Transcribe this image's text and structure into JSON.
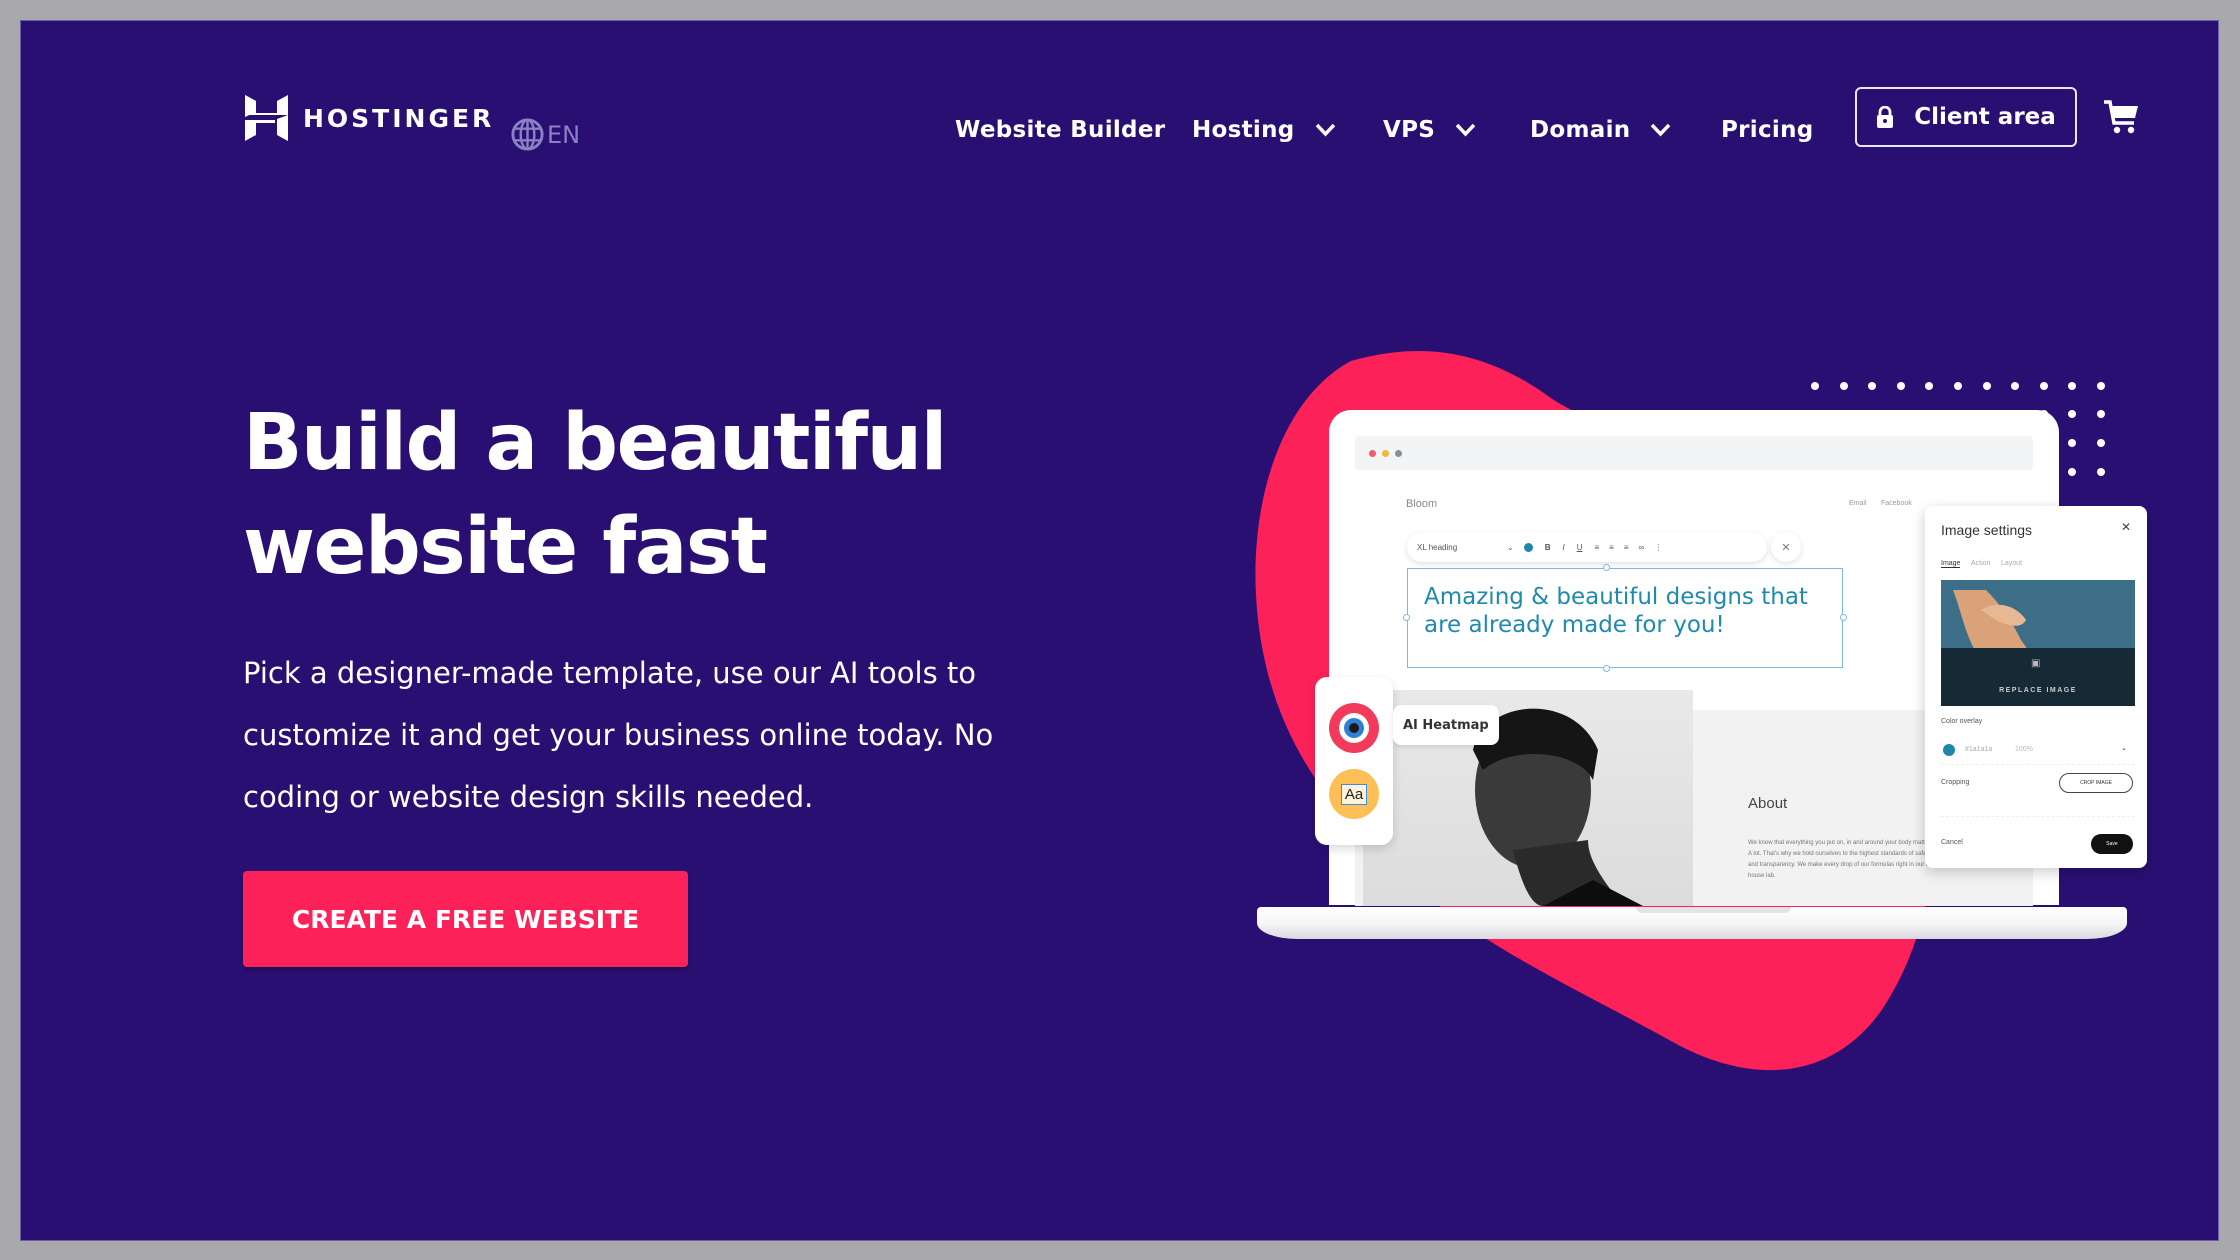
{
  "header": {
    "brand": "HOSTINGER",
    "language": "EN",
    "nav": [
      {
        "label": "Website Builder",
        "has_dropdown": false
      },
      {
        "label": "Hosting",
        "has_dropdown": true
      },
      {
        "label": "VPS",
        "has_dropdown": true
      },
      {
        "label": "Domain",
        "has_dropdown": true
      },
      {
        "label": "Pricing",
        "has_dropdown": false
      }
    ],
    "client_area_label": "Client area",
    "icons": {
      "logo": "hostinger-logo-icon",
      "language": "globe-icon",
      "chevron": "chevron-down-icon",
      "lock": "lock-icon",
      "cart": "cart-icon"
    }
  },
  "hero": {
    "title_line1": "Build a beautiful",
    "title_line2": "website fast",
    "description": "Pick a designer-made template, use our AI tools to customize it and get your business online today. No coding or website design skills needed.",
    "cta_label": "CREATE A FREE WEBSITE"
  },
  "illustration": {
    "site_brand": "Bloom",
    "site_nav": [
      "Email",
      "Facebook"
    ],
    "toolbar_style": "XL heading",
    "editable_heading": "Amazing & beautiful designs that are already made for you!",
    "ai_heatmap_label": "AI Heatmap",
    "aa_icon_label": "Aa",
    "about_title": "About",
    "about_text": "We know that everything you put on, in and around your body matters. A lot. That's why we hold ourselves to the highest standards of safety and transparency. We make every drop of our formulas right in our in-house lab.",
    "panel": {
      "title": "Image settings",
      "tabs": [
        "Image",
        "Action",
        "Layout"
      ],
      "active_tab": "Image",
      "replace_label": "REPLACE IMAGE",
      "color_overlay_label": "Color overlay",
      "color_value": "#1a1a1a",
      "opacity_value": "100%",
      "cropping_label": "Cropping",
      "crop_button_label": "CROP IMAGE",
      "cancel_label": "Cancel",
      "save_label": "Save"
    }
  },
  "colors": {
    "background": "#2a0f72",
    "accent": "#fc2158",
    "heading_teal": "#1f8ab0"
  }
}
